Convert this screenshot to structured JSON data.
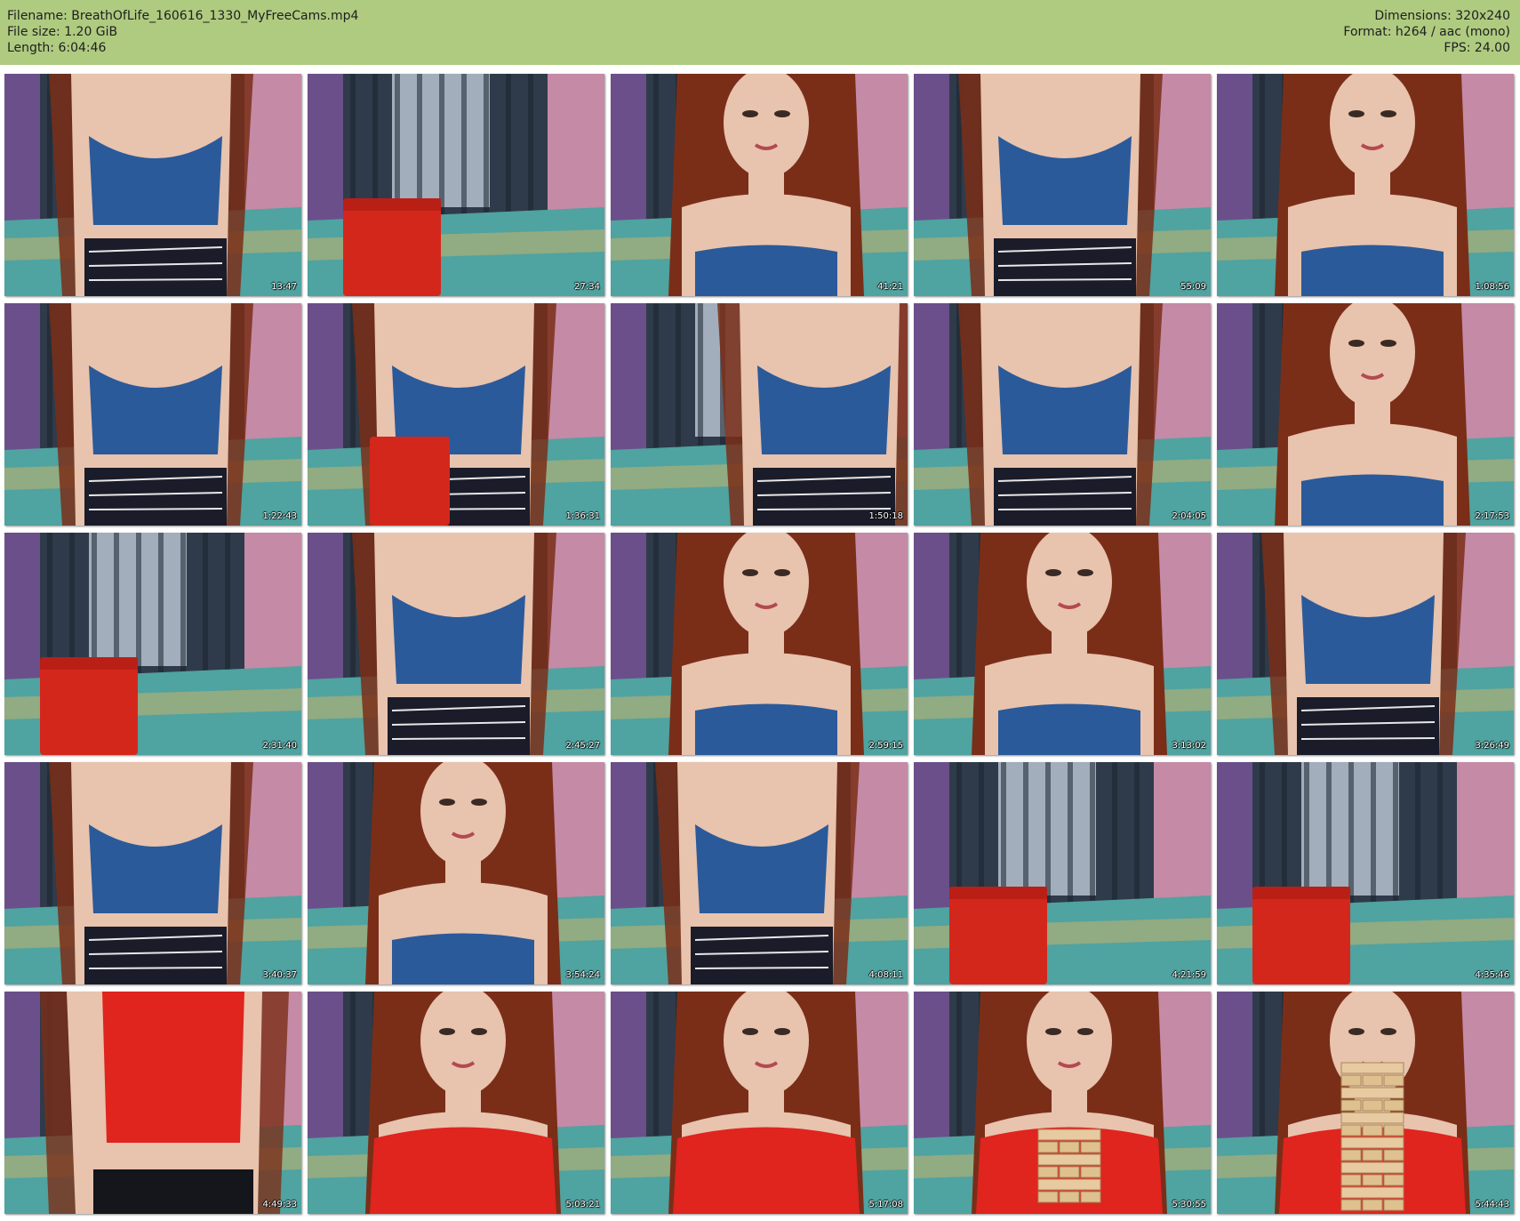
{
  "header": {
    "filename_line": "Filename: BreathOfLife_160616_1330_MyFreeCams.mp4",
    "filesize_line": "File size: 1.20 GiB",
    "length_line": "Length: 6:04:46",
    "dimensions_line": "Dimensions: 320x240",
    "format_line": "Format: h264 / aac (mono)",
    "fps_line": "FPS: 24.00",
    "background_color": "#aecb80"
  },
  "thumbnails": [
    {
      "timestamp": "13:47",
      "scene": "torso-denim"
    },
    {
      "timestamp": "27:34",
      "scene": "room-chair"
    },
    {
      "timestamp": "41:21",
      "scene": "face-denim"
    },
    {
      "timestamp": "55:09",
      "scene": "torso-denim"
    },
    {
      "timestamp": "1:08:56",
      "scene": "face-denim"
    },
    {
      "timestamp": "1:22:43",
      "scene": "torso-denim"
    },
    {
      "timestamp": "1:36:31",
      "scene": "torso-chair"
    },
    {
      "timestamp": "1:50:18",
      "scene": "torso-side"
    },
    {
      "timestamp": "2:04:05",
      "scene": "torso-denim"
    },
    {
      "timestamp": "2:17:53",
      "scene": "face-denim"
    },
    {
      "timestamp": "2:31:40",
      "scene": "room-chair"
    },
    {
      "timestamp": "2:45:27",
      "scene": "torso-denim"
    },
    {
      "timestamp": "2:59:15",
      "scene": "face-denim"
    },
    {
      "timestamp": "3:13:02",
      "scene": "face-denim"
    },
    {
      "timestamp": "3:26:49",
      "scene": "torso-denim"
    },
    {
      "timestamp": "3:40:37",
      "scene": "torso-denim"
    },
    {
      "timestamp": "3:54:24",
      "scene": "face-denim"
    },
    {
      "timestamp": "4:08:11",
      "scene": "torso-denim"
    },
    {
      "timestamp": "4:21:59",
      "scene": "room-chair"
    },
    {
      "timestamp": "4:35:46",
      "scene": "room-chair"
    },
    {
      "timestamp": "4:49:33",
      "scene": "torso-red"
    },
    {
      "timestamp": "5:03:21",
      "scene": "face-red"
    },
    {
      "timestamp": "5:17:08",
      "scene": "face-red"
    },
    {
      "timestamp": "5:30:55",
      "scene": "face-red-blocks"
    },
    {
      "timestamp": "5:44:43",
      "scene": "face-red-tower"
    }
  ],
  "colors": {
    "denim_top": "#2a5a9a",
    "red_top": "#e0241e",
    "red_chair": "#d4271c",
    "hair": "#7a2e18",
    "skin": "#e8c3ae",
    "bedspread": "#4fa3a0",
    "curtain": "#2f3b4a",
    "wall_left": "#6b4f8a",
    "wall_pink": "#c58aa6"
  }
}
